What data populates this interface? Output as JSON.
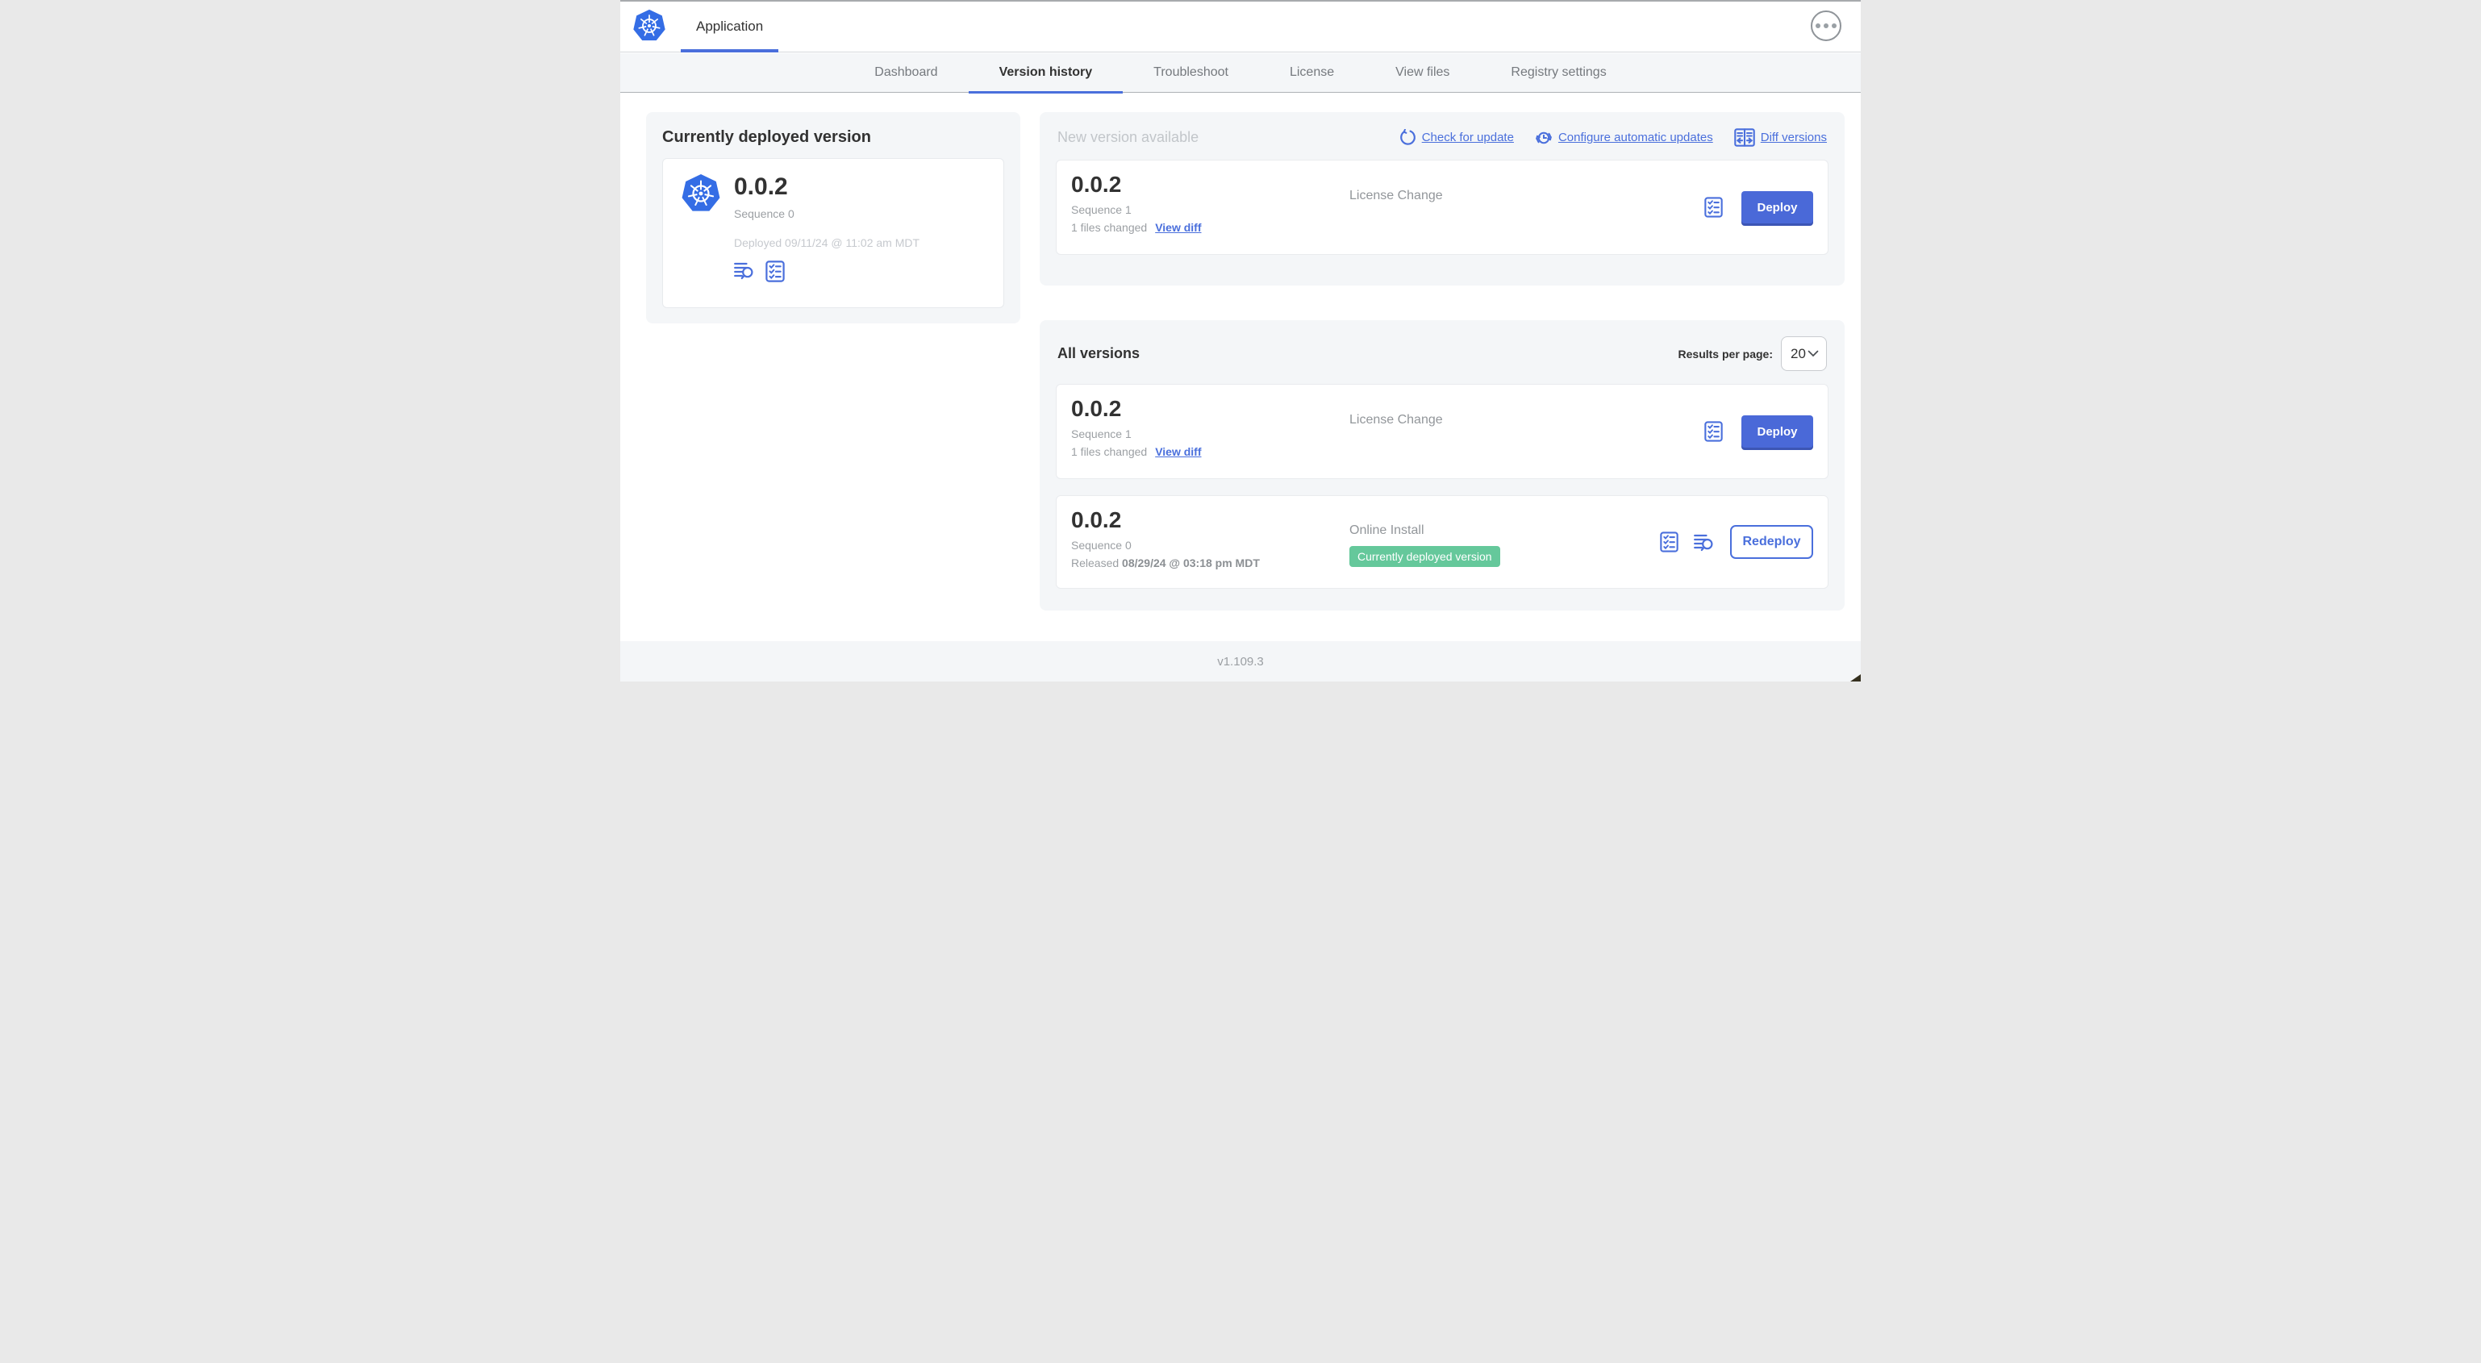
{
  "colors": {
    "accent_blue": "#4a6fdc",
    "button_blue": "#4a69d8",
    "badge_green": "#65c89b",
    "panel_gray": "#f4f6f8"
  },
  "header": {
    "app_title": "Application"
  },
  "nav": {
    "tabs": [
      "Dashboard",
      "Version history",
      "Troubleshoot",
      "License",
      "View files",
      "Registry settings"
    ],
    "active_tab": "Version history"
  },
  "deployed": {
    "title": "Currently deployed version",
    "version": "0.0.2",
    "sequence": "Sequence 0",
    "deployed_at": "Deployed 09/11/24 @ 11:02 am MDT"
  },
  "new_version": {
    "title": "New version available",
    "actions": {
      "check": "Check for update",
      "configure": "Configure automatic updates",
      "diff": "Diff versions"
    },
    "row": {
      "version": "0.0.2",
      "sequence": "Sequence 1",
      "files_changed": "1 files changed",
      "view_diff": "View diff",
      "source": "License Change",
      "action": "Deploy"
    }
  },
  "all_versions": {
    "title": "All versions",
    "results_per_page_label": "Results per page:",
    "results_per_page_value": "20",
    "rows": [
      {
        "version": "0.0.2",
        "sequence": "Sequence 1",
        "files_changed": "1 files changed",
        "view_diff": "View diff",
        "source": "License Change",
        "action": "Deploy"
      },
      {
        "version": "0.0.2",
        "sequence": "Sequence 0",
        "released_prefix": "Released ",
        "released_date": "08/29/24 @ 03:18 pm MDT",
        "source": "Online Install",
        "badge": "Currently deployed version",
        "action": "Redeploy"
      }
    ]
  },
  "footer": {
    "version": "v1.109.3"
  }
}
